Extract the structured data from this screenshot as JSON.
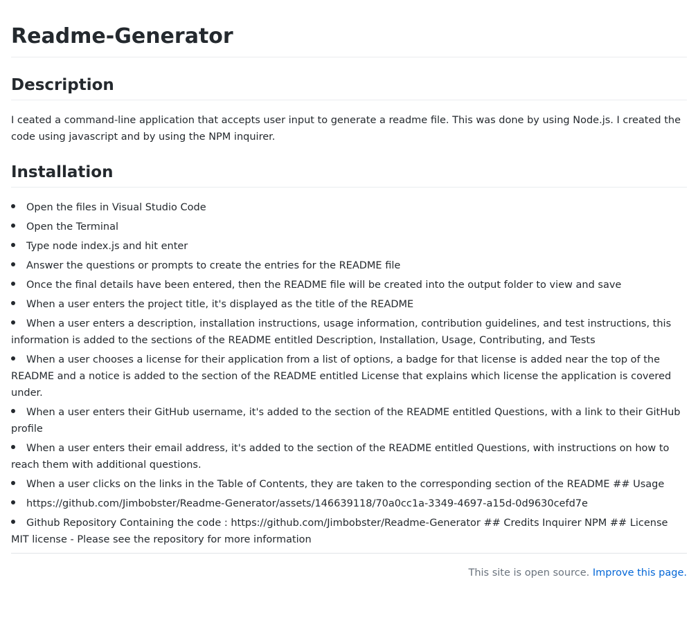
{
  "page": {
    "title": "Readme-Generator"
  },
  "description": {
    "heading": "Description",
    "text": "I ceated a command-line application that accepts user input to generate a readme file. This was done by using Node.js. I created the code using javascript and by using the NPM inquirer."
  },
  "installation": {
    "heading": "Installation",
    "items": [
      "Open the files in Visual Studio Code",
      "Open the Terminal",
      "Type node index.js and hit enter",
      "Answer the questions or prompts to create the entries for the README file",
      "Once the final details have been entered, then the README file will be created into the output folder to view and save",
      "When a user enters the project title, it's displayed as the title of the README",
      "When a user enters a description, installation instructions, usage information, contribution guidelines, and test instructions, this information is added to the sections of the README entitled Description, Installation, Usage, Contributing, and Tests",
      "When a user chooses a license for their application from a list of options, a badge for that license is added near the top of the README and a notice is added to the section of the README entitled License that explains which license the application is covered under.",
      "When a user enters their GitHub username, it's added to the section of the README entitled Questions, with a link to their GitHub profile",
      "When a user enters their email address, it's added to the section of the README entitled Questions, with instructions on how to reach them with additional questions.",
      "When a user clicks on the links in the Table of Contents, they are taken to the corresponding section of the README ## Usage",
      "https://github.com/Jimbobster/Readme-Generator/assets/146639118/70a0cc1a-3349-4697-a15d-0d9630cefd7e",
      "Github Repository Containing the code : https://github.com/Jimbobster/Readme-Generator ## Credits Inquirer NPM ## License MIT license - Please see the repository for more information"
    ]
  },
  "footer": {
    "text": "This site is open source.",
    "link": "Improve this page."
  },
  "colors": {
    "text": "#24292e",
    "muted": "#6a737d",
    "link": "#0366d6",
    "rule": "#eaecef"
  }
}
